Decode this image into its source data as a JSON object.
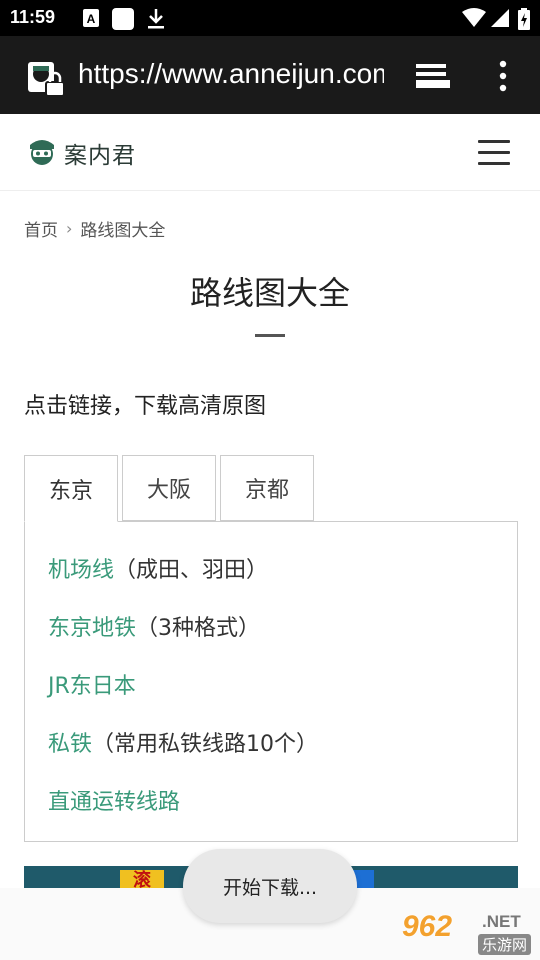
{
  "status_bar": {
    "time": "11:59"
  },
  "browser": {
    "url": "https://www.anneijun.com"
  },
  "site": {
    "logo_text": "案内君"
  },
  "breadcrumb": {
    "home": "首页",
    "current": "路线图大全"
  },
  "page": {
    "title": "路线图大全",
    "intro": "点击链接，下载高清原图"
  },
  "tabs": [
    {
      "label": "东京",
      "active": true
    },
    {
      "label": "大阪",
      "active": false
    },
    {
      "label": "京都",
      "active": false
    }
  ],
  "links": [
    {
      "text": "机场线",
      "note": "（成田、羽田）"
    },
    {
      "text": "东京地铁",
      "note": "（3种格式）"
    },
    {
      "text": "JR东日本",
      "note": ""
    },
    {
      "text": "私铁",
      "note": "（常用私铁线路10个）"
    },
    {
      "text": "直通运转线路",
      "note": ""
    }
  ],
  "toast": {
    "text": "开始下载..."
  },
  "banner": {
    "sticker_text": "滚"
  },
  "watermark": {
    "number": "962",
    "net": ".NET",
    "site_cn": "乐游网"
  },
  "colors": {
    "link": "#3a9a7a",
    "status_bar": "#000000",
    "url_bar": "#1a1a1a"
  },
  "icons": [
    "A-notification-icon",
    "app-notification-icon",
    "download-icon",
    "wifi-icon",
    "signal-icon",
    "battery-icon",
    "site-lock-icon",
    "tabs-icon",
    "overflow-menu-icon",
    "logo-icon",
    "hamburger-menu-icon",
    "chevron-right-icon"
  ]
}
